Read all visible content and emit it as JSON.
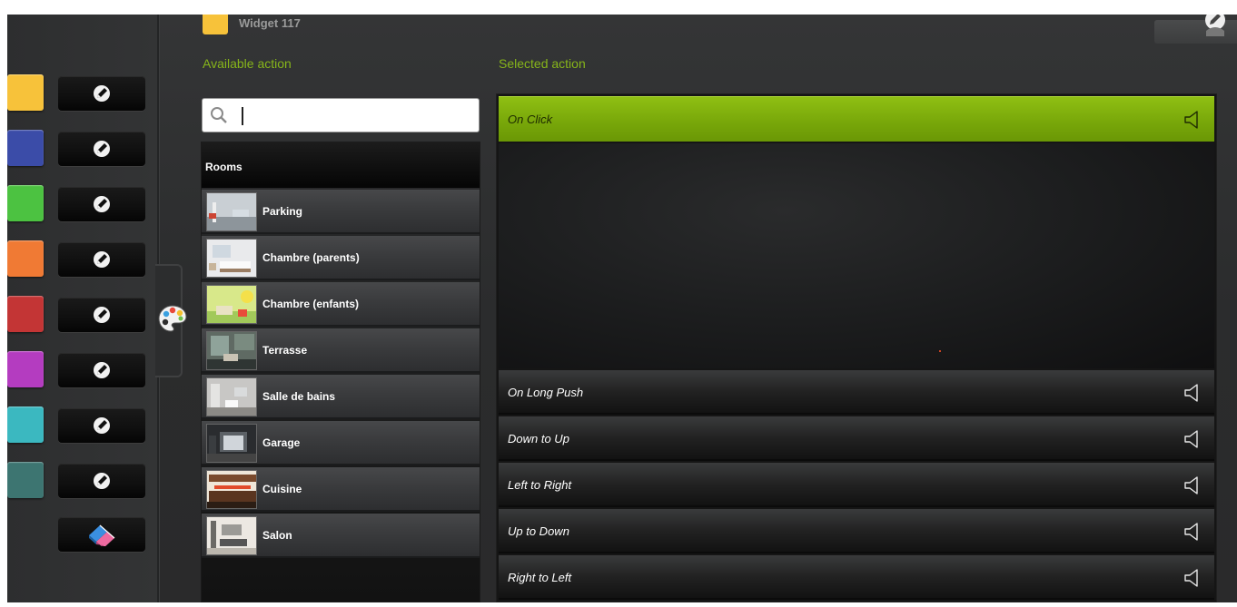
{
  "header": {
    "widget_title": "Widget 117",
    "widget_color": "#f7c23a"
  },
  "labels": {
    "available_action": "Available action",
    "selected_action": "Selected action"
  },
  "search": {
    "value": "",
    "placeholder": ""
  },
  "color_swatches": [
    {
      "name": "yellow",
      "color": "#f7c23a"
    },
    {
      "name": "blue",
      "color": "#3b4ca8"
    },
    {
      "name": "green",
      "color": "#4cc241"
    },
    {
      "name": "orange",
      "color": "#f07a34"
    },
    {
      "name": "red",
      "color": "#c33535"
    },
    {
      "name": "purple",
      "color": "#b43cc0"
    },
    {
      "name": "cyan",
      "color": "#3bb8c0"
    },
    {
      "name": "teal",
      "color": "#3d7571"
    }
  ],
  "rooms": {
    "header": "Rooms",
    "items": [
      {
        "label": "Parking",
        "thumb": "parking"
      },
      {
        "label": "Chambre (parents)",
        "thumb": "bedroom"
      },
      {
        "label": "Chambre (enfants)",
        "thumb": "kids"
      },
      {
        "label": "Terrasse",
        "thumb": "terrace"
      },
      {
        "label": "Salle de bains",
        "thumb": "bathroom"
      },
      {
        "label": "Garage",
        "thumb": "garage"
      },
      {
        "label": "Cuisine",
        "thumb": "kitchen"
      },
      {
        "label": "Salon",
        "thumb": "living"
      }
    ]
  },
  "actions": {
    "selected": "On Click",
    "items": [
      "On Long Push",
      "Down to Up",
      "Left to Right",
      "Up to Down",
      "Right to Left"
    ]
  },
  "colors": {
    "accent_green": "#86b51a",
    "selected_header": "#7cab0b"
  },
  "icons": {
    "edit": "edit-icon",
    "eraser": "eraser-icon",
    "palette": "palette-icon",
    "search": "search-icon",
    "speaker": "speaker-icon"
  }
}
